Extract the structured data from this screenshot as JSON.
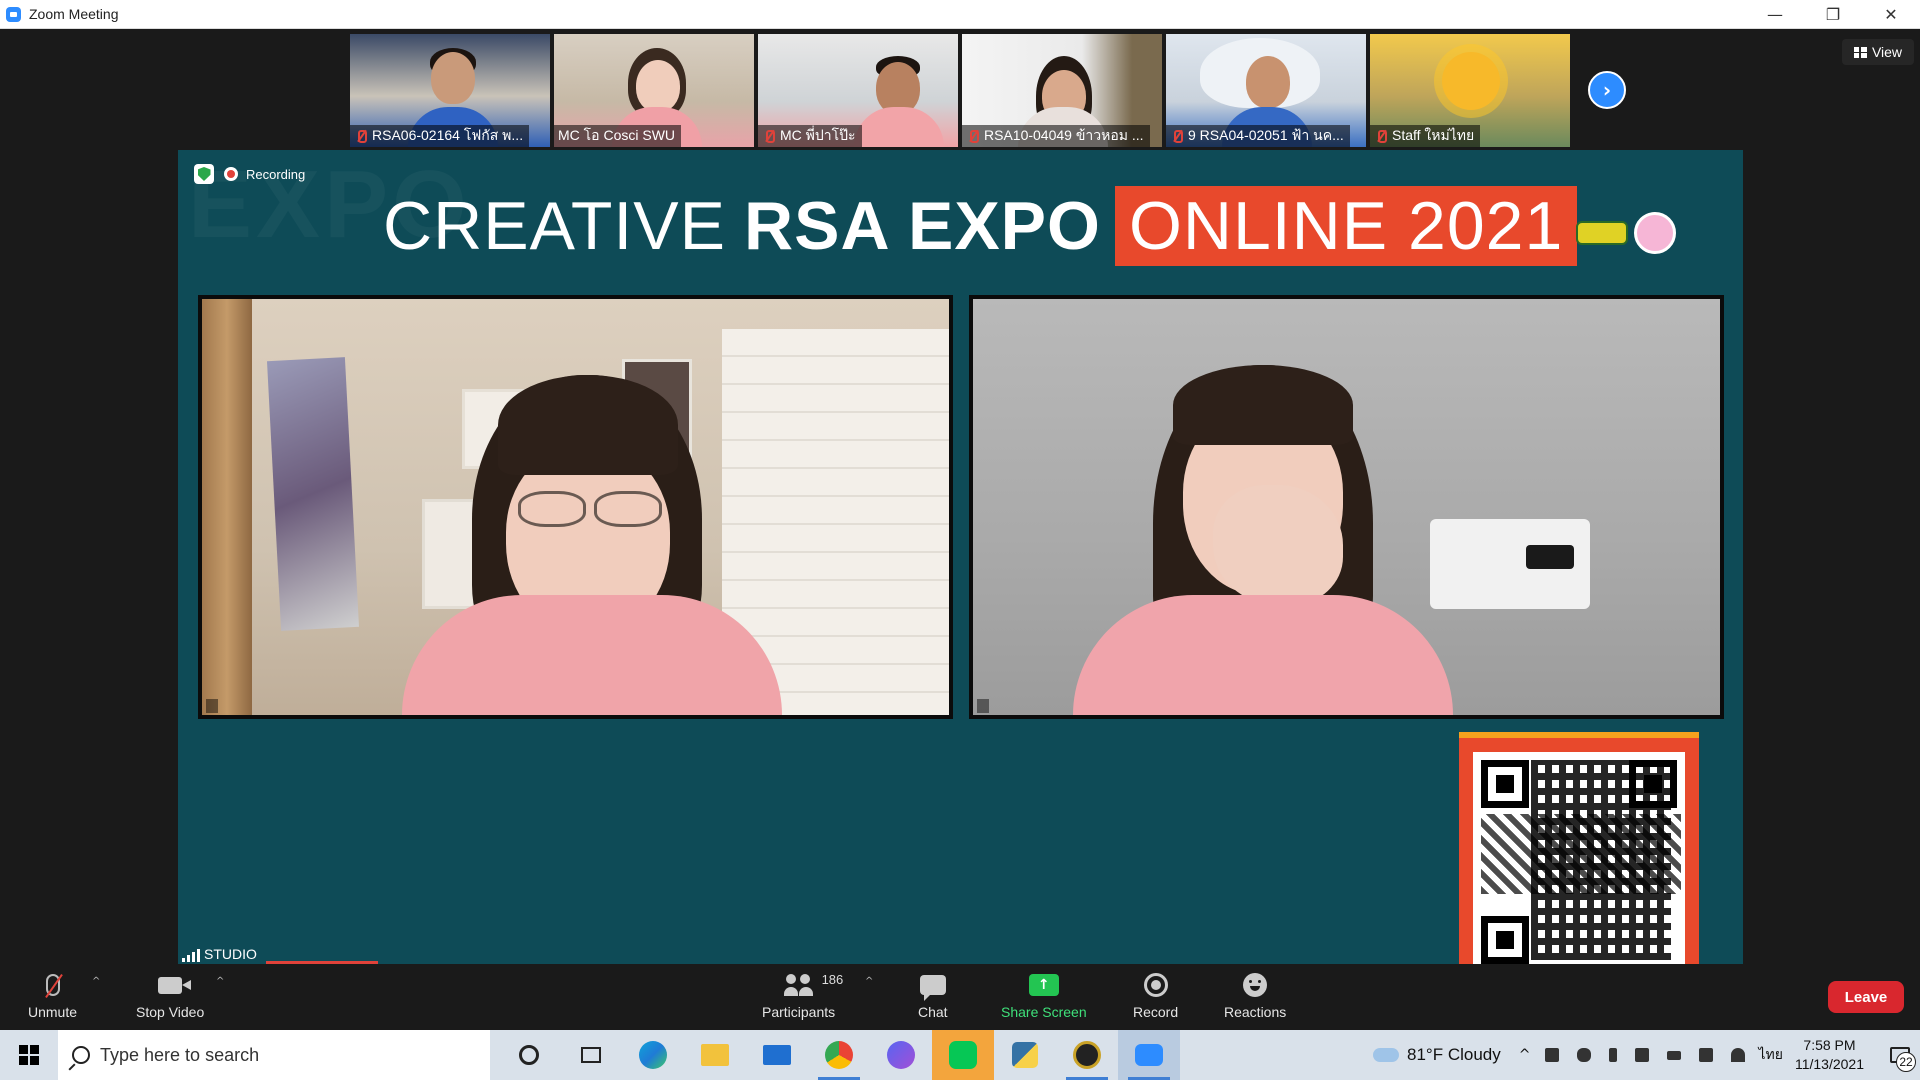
{
  "window": {
    "title": "Zoom Meeting",
    "controls": {
      "minimize": "—",
      "restore": "❐",
      "close": "✕"
    }
  },
  "gallery": {
    "participants": [
      {
        "name": "RSA06-02164 โฟกัส พ..."
      },
      {
        "name": "MC โอ Cosci SWU"
      },
      {
        "name": "MC พี่ปาโป๊ะ"
      },
      {
        "name": "RSA10-04049 ข้าวหอม ..."
      },
      {
        "name": "9 RSA04-02051 ฟ้า นค..."
      },
      {
        "name": "Staff ใหม่ไทย"
      }
    ],
    "next_icon": "›",
    "view_label": "View"
  },
  "stage": {
    "recording_label": "Recording",
    "bg_watermark": "EXPO",
    "banner": {
      "part1": "CREATIVE",
      "part2": "RSA EXPO",
      "part3": "ONLINE 2021"
    },
    "studio_label": "STUDIO"
  },
  "toolbar": {
    "unmute": "Unmute",
    "stop_video": "Stop Video",
    "participants": "Participants",
    "participants_count": "186",
    "chat": "Chat",
    "share_screen": "Share Screen",
    "share_icon": "↑",
    "record": "Record",
    "reactions": "Reactions",
    "leave": "Leave",
    "caret": "^"
  },
  "taskbar": {
    "search_placeholder": "Type here to search",
    "weather": "81°F  Cloudy",
    "language": "ไทย",
    "time": "7:58 PM",
    "date": "11/13/2021",
    "notifications": "22"
  },
  "colors": {
    "stage_bg": "#0e4b57",
    "accent_orange": "#e8492c",
    "zoom_blue": "#2d8cff",
    "leave_red": "#d9272e",
    "share_green": "#23c552"
  }
}
